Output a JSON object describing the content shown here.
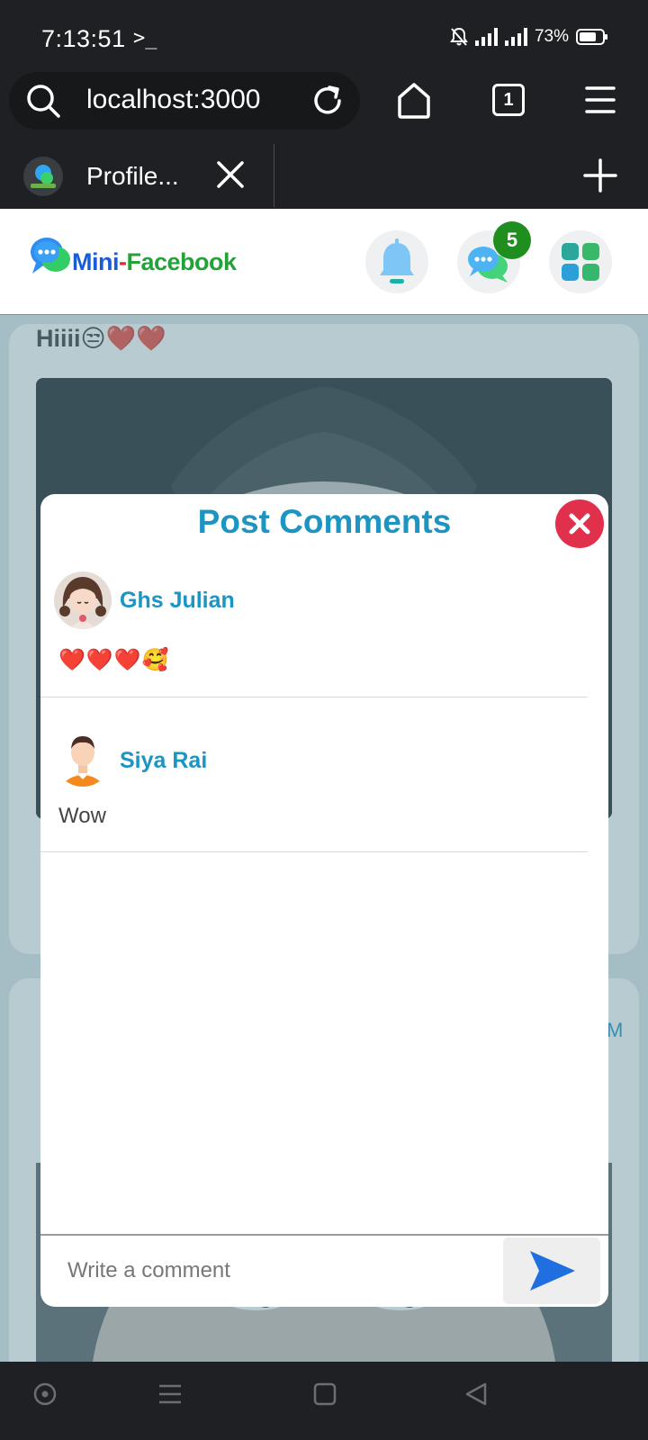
{
  "status_bar": {
    "time": "7:13:51",
    "terminal_glyph": ">_",
    "battery": "73%",
    "battery_level": 0.73
  },
  "browser": {
    "url": "localhost:3000",
    "tab_count": "1",
    "tab_title": "Profile..."
  },
  "header": {
    "logo_part1": "Mini",
    "logo_dash": "-",
    "logo_part2": "Facebook",
    "message_badge": "5",
    "icons": [
      "bell-icon",
      "messenger-icon",
      "apps-grid-icon"
    ]
  },
  "feed": {
    "post_text": "Hiiii😒❤️❤️",
    "second_card_time_fragment": "M"
  },
  "modal": {
    "title": "Post Comments",
    "comments": [
      {
        "name": "Ghs Julian",
        "text": "❤️❤️❤️🥰"
      },
      {
        "name": "Siya Rai",
        "text": "Wow"
      }
    ],
    "input_placeholder": "Write a comment"
  },
  "colors": {
    "accent": "#1c95c2",
    "close_red": "#e0304c",
    "send_blue": "#1f6fe0",
    "badge_green": "#1f8e1f"
  }
}
